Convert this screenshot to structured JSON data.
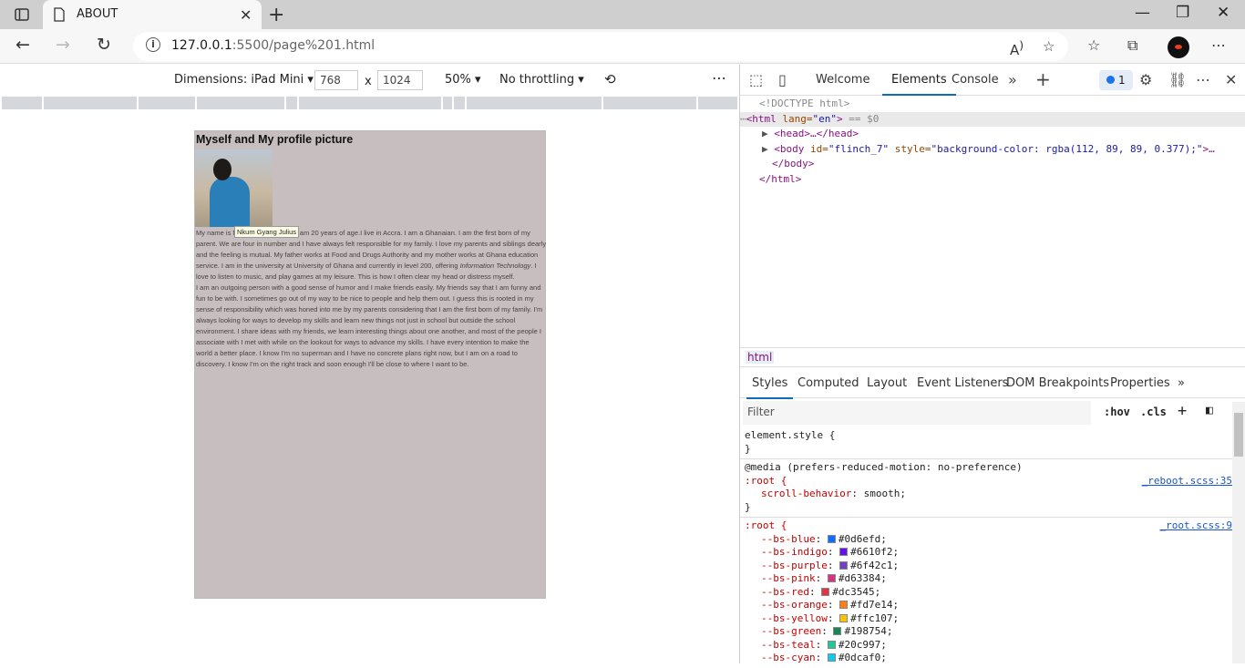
{
  "browser": {
    "tab_title": "ABOUT",
    "url_host": "127.0.0.1",
    "url_rest": ":5500/page%201.html"
  },
  "emulation": {
    "dimensions": "Dimensions: iPad Mini",
    "width": "768",
    "x": "x",
    "height": "1024",
    "zoom": "50%",
    "throttling": "No throttling",
    "more": "⋯"
  },
  "page": {
    "heading": "Myself and My profile picture",
    "tooltip": "Nkum Gyang Julius",
    "bio_p1": "My name is Nkum Gyang Julius. I am 20 years of age.I live in Accra. I am a Ghanaian. I am the first born of my parent. We are four in number and I have always felt responsible for my family. I love my parents and siblings dearly and the feeling is mutual. My father works at Food and Drugs Authority and my mother works at Ghana education service. I am in the university at University of Ghana and currently in level 200, offering ",
    "bio_p1_em": "Information Technology",
    "bio_p1_end": ". I love to listen to music, and play games at my leisure. This is how I often clear my head or distress myself.",
    "bio_p2": "I am an outgoing person with a good sense of humor and I make friends easily. My friends say that I am funny and fun to be with. I sometimes go out of my way to be nice to people and help them out. I guess this is rooted in my sense of responsibility which was honed into me by my parents considering that I am the first born of my family. I'm always looking for ways to develop my skills and learn new things not just in school but outside the school environment. I share ideas with my friends, we learn interesting things about one another, and most of the people I associate with I met with while on the lookout for ways to advance my skills. I have every intention to make the world a better place. I know I'm no superman and I have no concrete plans right now, but I am on a road to discovery. I know I'm on the right track and soon enough I'll be close to where I want to be."
  },
  "devtools": {
    "tabs": [
      "Welcome",
      "Elements",
      "Console"
    ],
    "issues_count": "1",
    "dom": {
      "doctype": "<!DOCTYPE html>",
      "html_open_tag": "<html",
      "html_lang_attr": " lang=",
      "html_lang_val": "\"en\"",
      "html_close_bracket": ">",
      "selected_marker": " == $0",
      "head": "<head>…</head>",
      "body_open": "<body",
      "body_id_attr": " id=",
      "body_id_val": "\"flinch_7\"",
      "body_style_attr": " style=",
      "body_style_val": "\"background-color: rgba(112, 89, 89, 0.377);\"",
      "body_rest": ">…",
      "body_close": "</body>",
      "html_close": "</html>",
      "dots": "⋯"
    },
    "breadcrumb": "html",
    "style_tabs": [
      "Styles",
      "Computed",
      "Layout",
      "Event Listeners",
      "DOM Breakpoints",
      "Properties"
    ],
    "filter_placeholder": "Filter",
    "hov": ":hov",
    "cls": ".cls",
    "rules": {
      "element_style": "element.style {",
      "close": "}",
      "media": "@media (prefers-reduced-motion: no-preference)",
      "root_sel": ":root {",
      "scroll_prop": "scroll-behavior",
      "scroll_val": "smooth;",
      "reboot_src": "_reboot.scss:35",
      "root_src": "_root.scss:9"
    },
    "vars": [
      {
        "name": "--bs-blue",
        "value": "#0d6efd",
        "color": "#0d6efd"
      },
      {
        "name": "--bs-indigo",
        "value": "#6610f2",
        "color": "#6610f2"
      },
      {
        "name": "--bs-purple",
        "value": "#6f42c1",
        "color": "#6f42c1"
      },
      {
        "name": "--bs-pink",
        "value": "#d63384",
        "color": "#d63384"
      },
      {
        "name": "--bs-red",
        "value": "#dc3545",
        "color": "#dc3545"
      },
      {
        "name": "--bs-orange",
        "value": "#fd7e14",
        "color": "#fd7e14"
      },
      {
        "name": "--bs-yellow",
        "value": "#ffc107",
        "color": "#ffc107"
      },
      {
        "name": "--bs-green",
        "value": "#198754",
        "color": "#198754"
      },
      {
        "name": "--bs-teal",
        "value": "#20c997",
        "color": "#20c997"
      },
      {
        "name": "--bs-cyan",
        "value": "#0dcaf0",
        "color": "#0dcaf0"
      }
    ]
  }
}
